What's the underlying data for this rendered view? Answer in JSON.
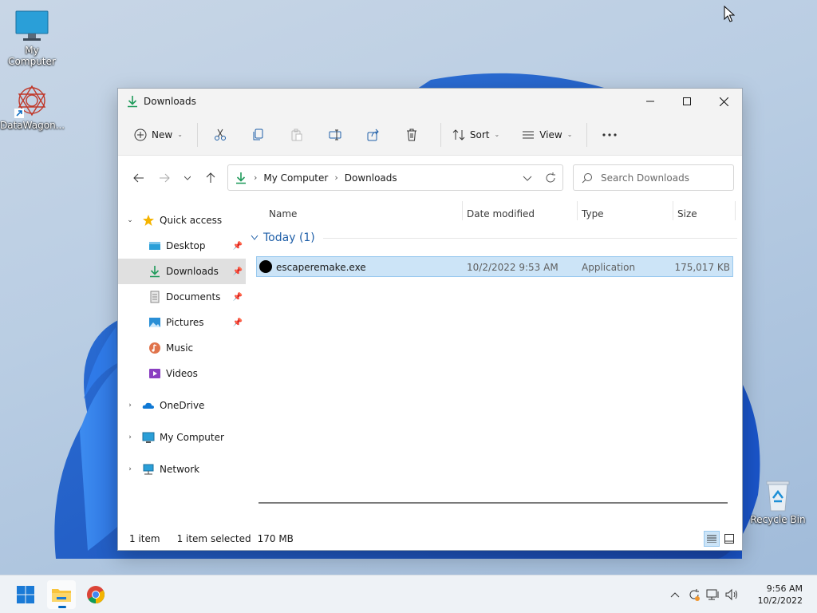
{
  "desktop": {
    "icons": [
      {
        "label": "My Computer",
        "icon": "monitor-icon"
      },
      {
        "label": "DataWagon...",
        "icon": "datawagon-shortcut-icon"
      },
      {
        "label": "Recycle Bin",
        "icon": "recycle-bin-icon"
      }
    ]
  },
  "window": {
    "title": "Downloads",
    "controls": {
      "minimize": "minimize-icon",
      "maximize": "maximize-icon",
      "close": "close-icon"
    }
  },
  "commandbar": {
    "new_label": "New",
    "sort_label": "Sort",
    "view_label": "View"
  },
  "address": {
    "crumbs": [
      "My Computer",
      "Downloads"
    ],
    "search_placeholder": "Search Downloads"
  },
  "sidebar": {
    "items": [
      {
        "label": "Quick access",
        "icon": "star-icon"
      },
      {
        "label": "Desktop",
        "icon": "desktop-folder-icon"
      },
      {
        "label": "Downloads",
        "icon": "download-icon"
      },
      {
        "label": "Documents",
        "icon": "documents-icon"
      },
      {
        "label": "Pictures",
        "icon": "pictures-icon"
      },
      {
        "label": "Music",
        "icon": "music-icon"
      },
      {
        "label": "Videos",
        "icon": "videos-icon"
      },
      {
        "label": "OneDrive",
        "icon": "cloud-icon"
      },
      {
        "label": "My Computer",
        "icon": "monitor-icon"
      },
      {
        "label": "Network",
        "icon": "network-icon"
      }
    ]
  },
  "columns": {
    "name": "Name",
    "date": "Date modified",
    "type": "Type",
    "size": "Size"
  },
  "group": {
    "label": "Today (1)"
  },
  "files": [
    {
      "name": "escaperemake.exe",
      "date": "10/2/2022 9:53 AM",
      "type": "Application",
      "size": "175,017 KB"
    }
  ],
  "status": {
    "count": "1 item",
    "selected": "1 item selected",
    "size": "170 MB"
  },
  "taskbar": {
    "time": "9:56 AM",
    "date": "10/2/2022"
  },
  "colors": {
    "accent": "#0067c0",
    "selection": "#cce4f7",
    "folder": "#f8c43c"
  }
}
